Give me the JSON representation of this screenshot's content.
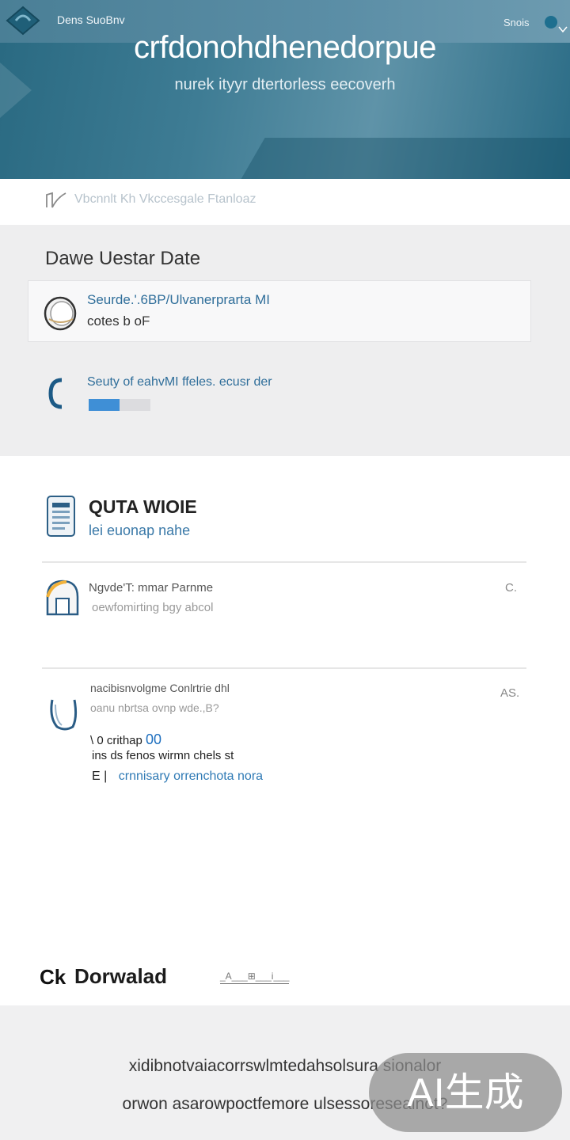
{
  "header": {
    "brand": "Dens SuoBnv",
    "signin": "Snois"
  },
  "hero": {
    "title": "crfdonohdhenedorpue",
    "subtitle": "nurek ityyr dtertorless eecoverh"
  },
  "strip": {
    "text": "Vbcnnlt Kh Vkccesgale Ftanloaz"
  },
  "section1": {
    "title": "Dawe Uestar Date",
    "card1": {
      "line1": "Seurde.'.6BP/Ulvanerprarta MI",
      "line2": "cotes b oF"
    },
    "card2": {
      "line1": "Seuty of eahvMI ffeles. ecusr der",
      "progress": 0.5
    }
  },
  "section2": {
    "title": "QUTA WIOIE",
    "subtitle": "lei euonap nahe",
    "item1": {
      "title": "Ngvde'T: mmar Parnme",
      "subtitle": "oewfomirting bgy abcol",
      "meta": "C."
    },
    "item2": {
      "title": "nacibisnvolgme Conlrtrie dhl",
      "subtitle": "oanu nbrtsa ovnp wde.,B?",
      "meta": "AS.",
      "row1_prefix": "\\ 0 crithap",
      "row1_accent": "00",
      "row2": "ins ds fenos wirmn chels st",
      "row3_prefix": "E |",
      "row3_link": "crnnisary orrenchota nora"
    }
  },
  "download": {
    "icon_glyph": "Ck",
    "label": "Dorwalad",
    "links": "_A___⊞___i___"
  },
  "footer": {
    "line1": "xidibnotvaiacorrswlmtedahsolsura sionalor",
    "line2": "orwon asarowpoctfemore ulsessoreseainot?"
  },
  "watermark": {
    "text": "AI生成"
  }
}
